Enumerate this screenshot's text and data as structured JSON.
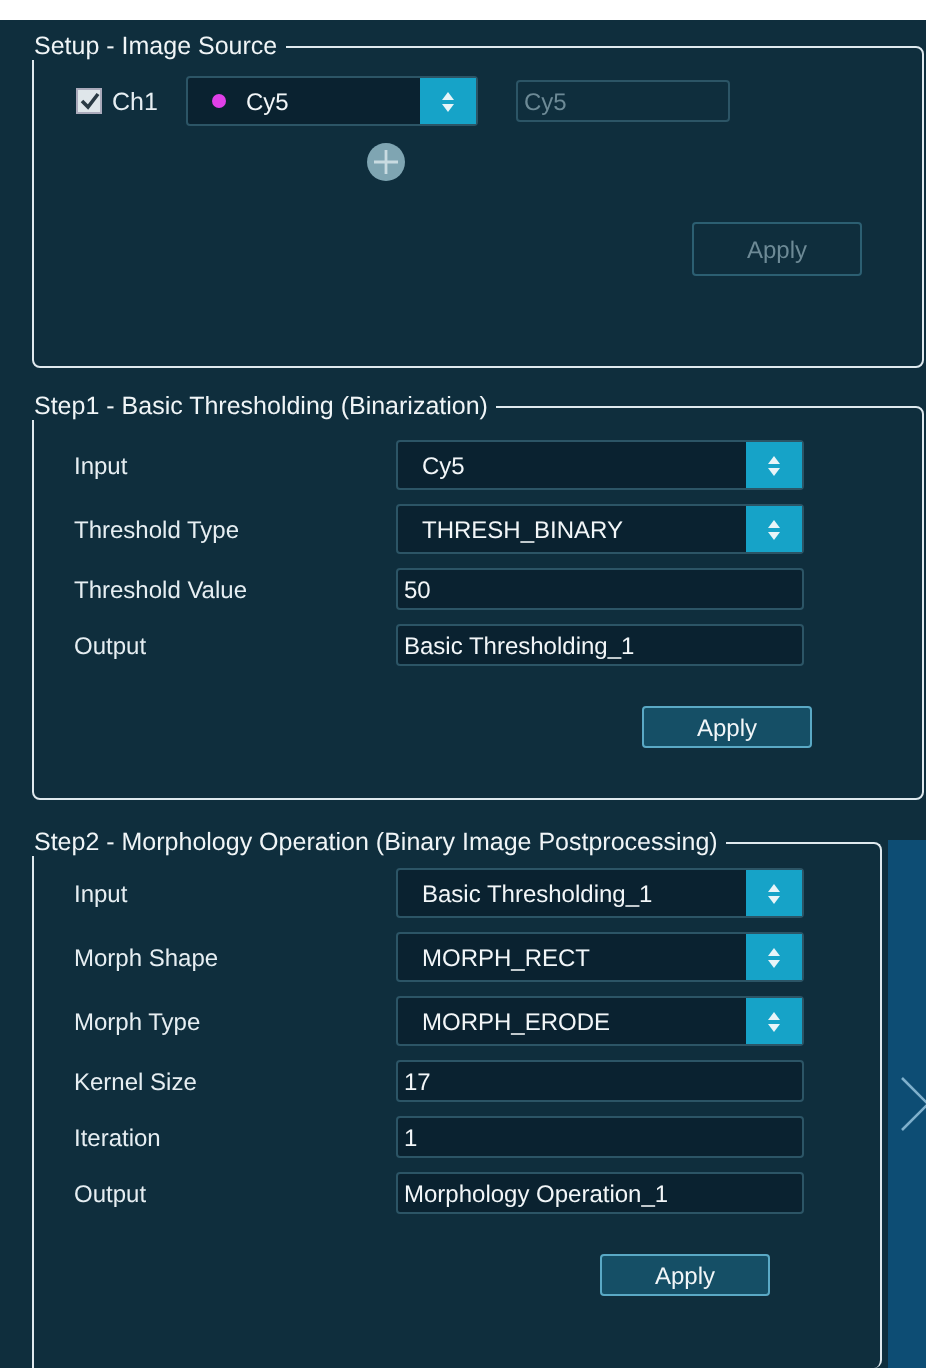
{
  "setup": {
    "title": "Setup - Image Source",
    "channel": {
      "label": "Ch1",
      "checked": true,
      "dropdown_value": "Cy5",
      "color": "#e040e8",
      "name_value": "Cy5",
      "name_disabled": true
    },
    "apply": {
      "label": "Apply",
      "disabled": true
    }
  },
  "steps": [
    {
      "title": "Step1 - Basic Thresholding (Binarization)",
      "rows": [
        {
          "kind": "dropdown",
          "label": "Input",
          "value": "Cy5"
        },
        {
          "kind": "dropdown",
          "label": "Threshold Type",
          "value": "THRESH_BINARY"
        },
        {
          "kind": "text",
          "label": "Threshold Value",
          "value": "50"
        },
        {
          "kind": "text",
          "label": "Output",
          "value": "Basic Thresholding_1"
        }
      ],
      "apply": {
        "label": "Apply",
        "disabled": false
      }
    },
    {
      "title": "Step2 - Morphology Operation (Binary Image Postprocessing)",
      "rows": [
        {
          "kind": "dropdown",
          "label": "Input",
          "value": "Basic Thresholding_1"
        },
        {
          "kind": "dropdown",
          "label": "Morph Shape",
          "value": "MORPH_RECT"
        },
        {
          "kind": "dropdown",
          "label": "Morph Type",
          "value": "MORPH_ERODE"
        },
        {
          "kind": "text",
          "label": "Kernel Size",
          "value": "17"
        },
        {
          "kind": "text",
          "label": "Iteration",
          "value": "1"
        },
        {
          "kind": "text",
          "label": "Output",
          "value": "Morphology Operation_1"
        }
      ],
      "apply": {
        "label": "Apply",
        "disabled": false
      }
    }
  ]
}
